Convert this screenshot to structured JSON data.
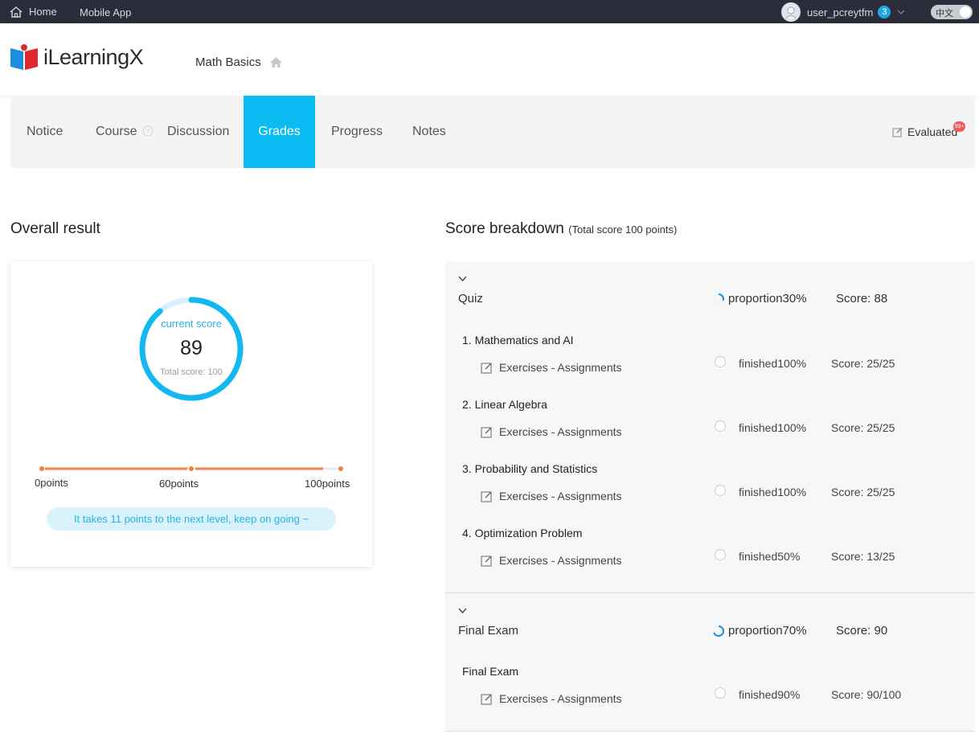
{
  "topbar": {
    "home_label": "Home",
    "mobile_label": "Mobile App",
    "username": "user_pcreytfm",
    "notification_count": "3",
    "language_label": "中文"
  },
  "header": {
    "logo_text": "iLearningX",
    "course_title": "Math Basics"
  },
  "tabs": [
    {
      "label": "Notice"
    },
    {
      "label": "Course"
    },
    {
      "label": "Discussion"
    },
    {
      "label": "Grades",
      "active": true
    },
    {
      "label": "Progress"
    },
    {
      "label": "Notes"
    }
  ],
  "evaluated": {
    "label": "Evaluated",
    "badge": "99+"
  },
  "overall": {
    "title": "Overall result",
    "current_score_label": "current score",
    "score": "89",
    "total_label": "Total score: 100",
    "score_fraction": 0.89,
    "levels": [
      "0points",
      "60points",
      "100points"
    ],
    "tip": "It takes 11 points to the next level, keep on going ~"
  },
  "breakdown": {
    "title": "Score breakdown",
    "subtitle": "(Total score 100 points)",
    "groups": [
      {
        "name": "Quiz",
        "proportion": "proportion30%",
        "proportion_value": 0.3,
        "score": "Score: 88",
        "items": [
          {
            "title": "1. Mathematics and AI",
            "sub": "Exercises - Assignments",
            "finished": "finished100%",
            "score": "Score: 25/25"
          },
          {
            "title": "2. Linear Algebra",
            "sub": "Exercises - Assignments",
            "finished": "finished100%",
            "score": "Score: 25/25"
          },
          {
            "title": "3. Probability and Statistics",
            "sub": "Exercises - Assignments",
            "finished": "finished100%",
            "score": "Score: 25/25"
          },
          {
            "title": "4. Optimization Problem",
            "sub": "Exercises - Assignments",
            "finished": "finished50%",
            "score": "Score: 13/25"
          }
        ]
      },
      {
        "name": "Final Exam",
        "proportion": "proportion70%",
        "proportion_value": 0.7,
        "score": "Score: 90",
        "items": [
          {
            "title": "Final Exam",
            "sub": "Exercises - Assignments",
            "finished": "finished90%",
            "score": "Score: 90/100"
          }
        ]
      }
    ]
  },
  "colors": {
    "accent": "#0bbcf2",
    "level_bar": "#f0824a",
    "topbar": "#2b2e3a"
  }
}
